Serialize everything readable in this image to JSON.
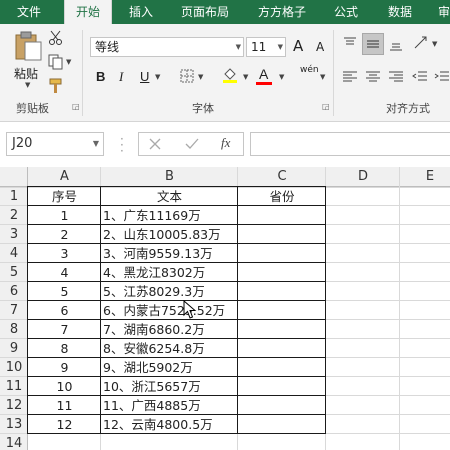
{
  "ribbon": {
    "tabs": [
      "文件",
      "开始",
      "插入",
      "页面布局",
      "方方格子",
      "公式",
      "数据",
      "审"
    ],
    "active_tab": "开始",
    "clipboard": {
      "paste_label": "粘贴",
      "group_label": "剪贴板"
    },
    "font": {
      "name": "等线",
      "size": "11",
      "group_label": "字体",
      "wen_label": "wén",
      "grow_label": "A",
      "shrink_label": "A",
      "bold": "B",
      "italic": "I",
      "underline": "U",
      "font_color": "A"
    },
    "alignment": {
      "group_label": "对齐方式"
    },
    "colors": {
      "accent": "#217346",
      "fill_swatch": "#ffff00",
      "font_swatch": "#ff0000"
    }
  },
  "formula_bar": {
    "name_box": "J20",
    "fx_label": "fx",
    "value": ""
  },
  "sheet": {
    "columns": [
      "A",
      "B",
      "C",
      "D",
      "E"
    ],
    "rows": [
      "1",
      "2",
      "3",
      "4",
      "5",
      "6",
      "7",
      "8",
      "9",
      "10",
      "11",
      "12",
      "13",
      "14"
    ],
    "header": [
      "序号",
      "文本",
      "省份"
    ],
    "data": [
      [
        "1",
        "1、广东11169万",
        ""
      ],
      [
        "2",
        "2、山东10005.83万",
        ""
      ],
      [
        "3",
        "3、河南9559.13万",
        ""
      ],
      [
        "4",
        "4、黑龙江8302万",
        ""
      ],
      [
        "5",
        "5、江苏8029.3万",
        ""
      ],
      [
        "6",
        "6、内蒙古7529.52万",
        ""
      ],
      [
        "7",
        "7、湖南6860.2万",
        ""
      ],
      [
        "8",
        "8、安徽6254.8万",
        ""
      ],
      [
        "9",
        "9、湖北5902万",
        ""
      ],
      [
        "10",
        "10、浙江5657万",
        ""
      ],
      [
        "11",
        "11、广西4885万",
        ""
      ],
      [
        "12",
        "12、云南4800.5万",
        ""
      ]
    ]
  }
}
